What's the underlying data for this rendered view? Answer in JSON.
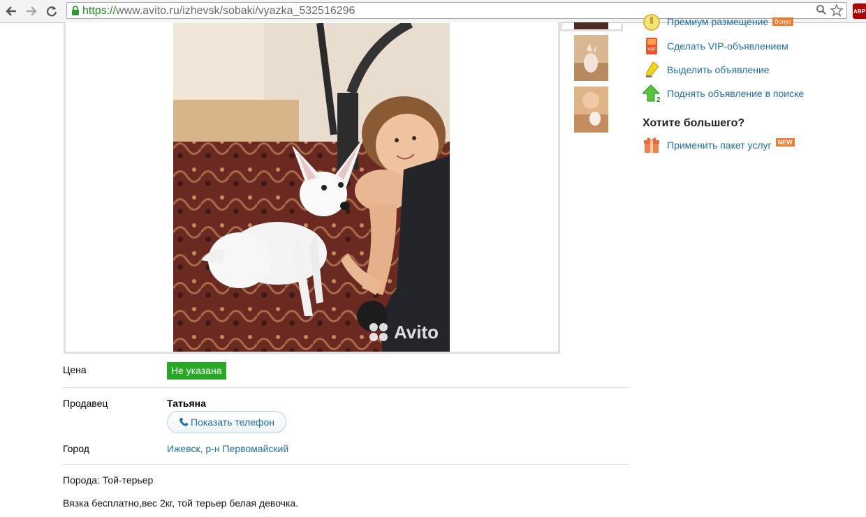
{
  "browser": {
    "url_scheme": "https://",
    "url_rest": "www.avito.ru/izhevsk/sobaki/vyazka_532516296",
    "adblock_label": "ABP"
  },
  "listing": {
    "watermark": "Avito",
    "price_label": "Цена",
    "price_value": "Не указана",
    "seller_label": "Продавец",
    "seller_name": "Татьяна",
    "phone_button": "Показать телефон",
    "city_label": "Город",
    "city_value": "Ижевск, р-н Первомайский",
    "breed_line": "Порода: Той-терьер",
    "description": "Вязка бесплатно,вес 2кг, той терьер белая девочка."
  },
  "services": {
    "items": [
      {
        "label": "Премиум размещение",
        "icon": "premium-medal-icon",
        "badge": "бонус"
      },
      {
        "label": "Сделать VIP-объявлением",
        "icon": "vip-icon"
      },
      {
        "label": "Выделить объявление",
        "icon": "highlighter-icon"
      },
      {
        "label": "Поднять объявление в поиске",
        "icon": "raise-arrow-icon"
      }
    ],
    "more_title": "Хотите большего?",
    "package_label": "Применить пакет услуг",
    "package_badge": "NEW"
  },
  "colors": {
    "link": "#1f6fa3",
    "price_badge": "#27a827",
    "badge": "#f07a30"
  }
}
